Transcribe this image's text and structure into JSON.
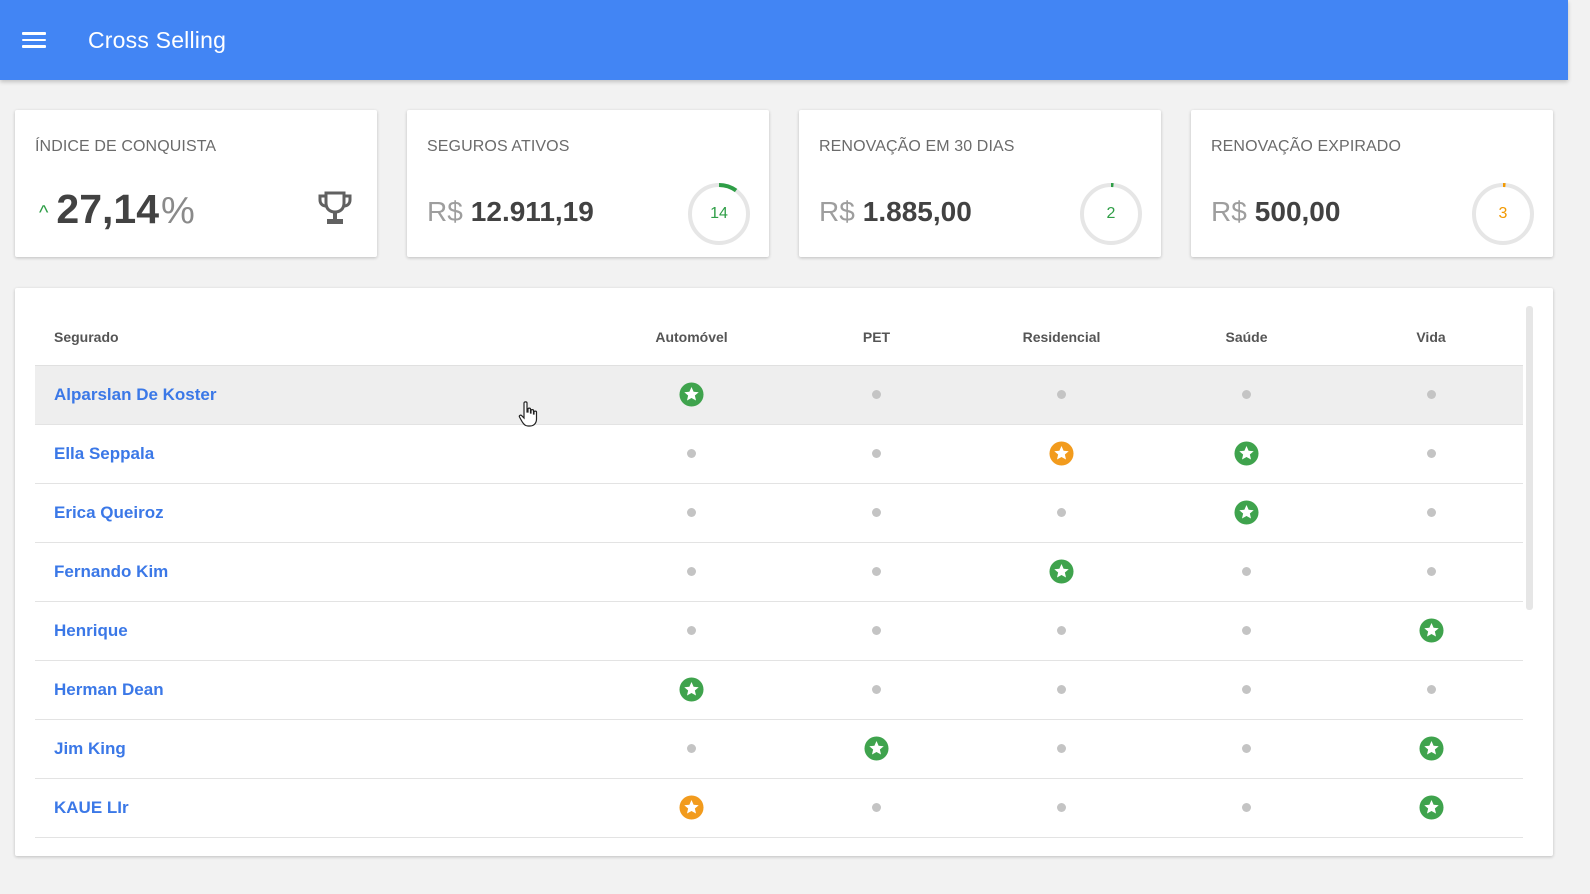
{
  "app": {
    "title": "Cross Selling"
  },
  "cards": {
    "conquista": {
      "title": "ÍNDICE DE CONQUISTA",
      "value": "27,14",
      "unit": "%"
    },
    "ativos": {
      "title": "SEGUROS ATIVOS",
      "currency": "R$",
      "amount": "12.911,19",
      "count": "14",
      "progress": 0.1,
      "color": "#2e9e46"
    },
    "renovacao30": {
      "title": "RENOVAÇÃO EM 30 DIAS",
      "currency": "R$",
      "amount": "1.885,00",
      "count": "2",
      "progress": 0.01,
      "color": "#2e9e46"
    },
    "expirado": {
      "title": "RENOVAÇÃO EXPIRADO",
      "currency": "R$",
      "amount": "500,00",
      "count": "3",
      "progress": 0.01,
      "color": "#f29900"
    }
  },
  "table": {
    "columns": [
      "Segurado",
      "Automóvel",
      "PET",
      "Residencial",
      "Saúde",
      "Vida"
    ],
    "rows": [
      {
        "name": "Alparslan De Koster",
        "status": [
          "green",
          "none",
          "none",
          "none",
          "none"
        ]
      },
      {
        "name": "Ella Seppala",
        "status": [
          "none",
          "none",
          "orange",
          "green",
          "none"
        ]
      },
      {
        "name": "Erica Queiroz",
        "status": [
          "none",
          "none",
          "none",
          "green",
          "none"
        ]
      },
      {
        "name": "Fernando Kim",
        "status": [
          "none",
          "none",
          "green",
          "none",
          "none"
        ]
      },
      {
        "name": "Henrique",
        "status": [
          "none",
          "none",
          "none",
          "none",
          "green"
        ]
      },
      {
        "name": "Herman Dean",
        "status": [
          "green",
          "none",
          "none",
          "none",
          "none"
        ]
      },
      {
        "name": "Jim King",
        "status": [
          "none",
          "green",
          "none",
          "none",
          "green"
        ]
      },
      {
        "name": "KAUE LIr",
        "status": [
          "orange",
          "none",
          "none",
          "none",
          "green"
        ]
      }
    ]
  },
  "colors": {
    "green": "#3fa34d",
    "orange": "#f29b1d",
    "appbar": "#4285f4",
    "link": "#3b78e7"
  }
}
